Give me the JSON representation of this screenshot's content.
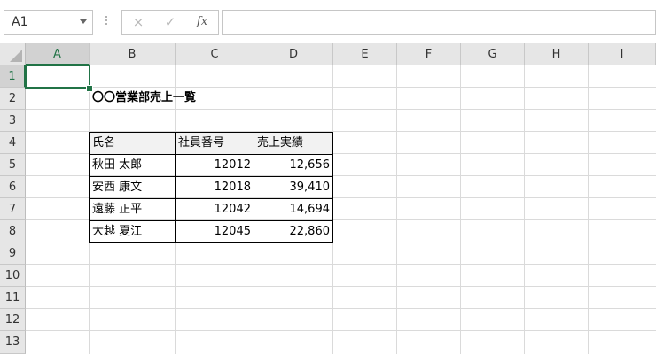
{
  "formula_bar": {
    "name_box": "A1",
    "cancel_icon": "×",
    "enter_icon": "✓",
    "fx_label": "fx",
    "formula": ""
  },
  "columns": [
    "A",
    "B",
    "C",
    "D",
    "E",
    "F",
    "G",
    "H",
    "I"
  ],
  "rows": [
    "1",
    "2",
    "3",
    "4",
    "5",
    "6",
    "7",
    "8",
    "9",
    "10",
    "11",
    "12",
    "13"
  ],
  "sheet": {
    "title": "〇〇営業部売上一覧",
    "table_headers": [
      "氏名",
      "社員番号",
      "売上実績"
    ],
    "table_rows": [
      [
        "秋田 太郎",
        "12012",
        "12,656"
      ],
      [
        "安西 康文",
        "12018",
        "39,410"
      ],
      [
        "遠藤 正平",
        "12042",
        "14,694"
      ],
      [
        "大越 夏江",
        "12045",
        "22,860"
      ]
    ]
  },
  "selection": {
    "active_cell": "A1",
    "accent_color": "#217346"
  }
}
